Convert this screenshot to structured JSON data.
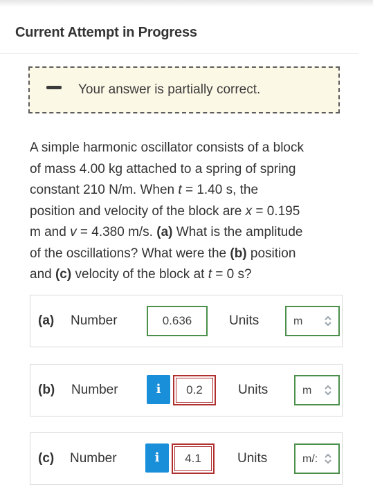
{
  "header": {
    "title": "Current Attempt in Progress"
  },
  "status": {
    "text": "Your answer is partially correct.",
    "icon": "minus-icon"
  },
  "question": {
    "line1": "A simple harmonic oscillator consists of a block",
    "line2": "of mass 4.00 kg attached to a spring of spring",
    "line3a": "constant 210 N/m. When ",
    "t": "t",
    "line3b": " = 1.40 s, the",
    "line4a": "position and velocity of the block are ",
    "x": "x",
    "line4b": " = 0.195",
    "line5a": "m and ",
    "v": "v",
    "line5b": " = 4.380 m/s. ",
    "part_a": "(a)",
    "line5c": " What is the amplitude",
    "line6a": "of the oscillations? What were the ",
    "part_b": "(b)",
    "line6b": " position",
    "line7a": "and ",
    "part_c": "(c)",
    "line7b": " velocity of the block at ",
    "t2": "t",
    "line7c": " = 0 s?"
  },
  "answers": [
    {
      "part": "(a)",
      "number_label": "Number",
      "value": "0.636",
      "units_label": "Units",
      "unit": "m",
      "status": "correct"
    },
    {
      "part": "(b)",
      "number_label": "Number",
      "info": "i",
      "value": "0.2",
      "units_label": "Units",
      "unit": "m",
      "status": "incorrect"
    },
    {
      "part": "(c)",
      "number_label": "Number",
      "info": "i",
      "value": "4.1",
      "units_label": "Units",
      "unit": "m/:",
      "status": "incorrect"
    }
  ],
  "colors": {
    "correct": "#4a8f4a",
    "incorrect": "#b03030",
    "info": "#1a8fd9",
    "status_bg": "#fcf8e6"
  }
}
